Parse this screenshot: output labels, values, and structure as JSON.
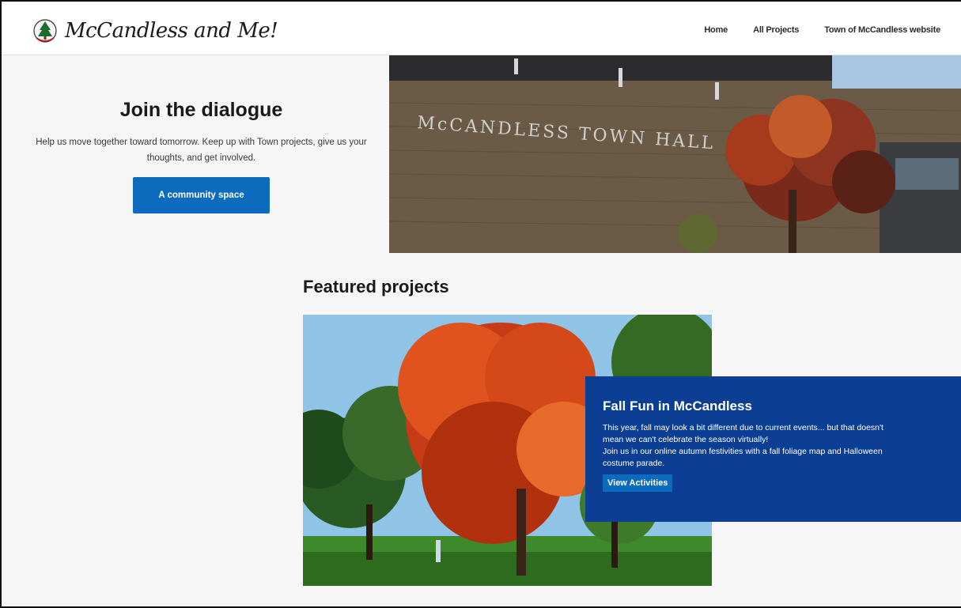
{
  "header": {
    "logo_text": "McCandless and Me!",
    "nav": [
      "Home",
      "All Projects",
      "Town of McCandless website"
    ]
  },
  "hero": {
    "title": "Join the dialogue",
    "description": "Help us move together toward tomorrow. Keep up with Town projects, give us your thoughts, and get involved.",
    "button_label": "A community space",
    "image_sign_text": "McCANDLESS TOWN HALL"
  },
  "featured": {
    "section_title": "Featured projects",
    "card": {
      "title": "Fall Fun in McCandless",
      "line1": "This year, fall may look a bit different due to current events... but that doesn't",
      "line2": "mean we can't celebrate the season virtually!",
      "line3": "Join us in our online autumn festivities with a fall foliage map and Halloween",
      "line4": "costume parade.",
      "button_label": "View Activities"
    }
  },
  "colors": {
    "primary_button": "#0d6bbd",
    "card_background": "#0c3f93",
    "page_background": "#f6f6f6"
  }
}
